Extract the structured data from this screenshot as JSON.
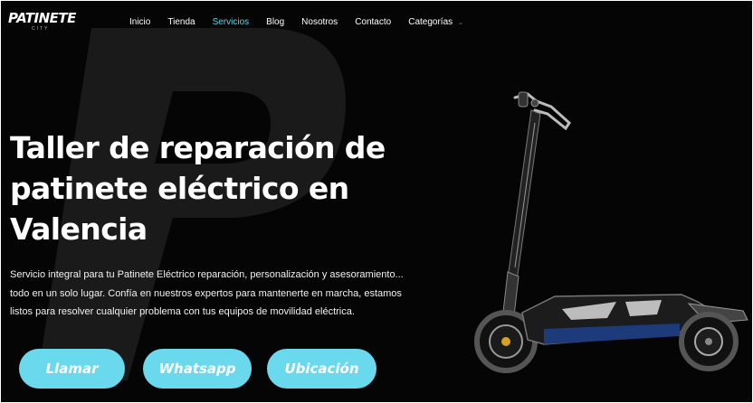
{
  "logo": {
    "text": "PATINETE",
    "subtext": "CITY"
  },
  "nav": {
    "items": [
      {
        "label": "Inicio",
        "active": false
      },
      {
        "label": "Tienda",
        "active": false
      },
      {
        "label": "Servicios",
        "active": true
      },
      {
        "label": "Blog",
        "active": false
      },
      {
        "label": "Nosotros",
        "active": false
      },
      {
        "label": "Contacto",
        "active": false
      },
      {
        "label": "Categorías",
        "active": false
      }
    ],
    "dropdown_icon": "chevron-down-icon"
  },
  "hero": {
    "title_lines": [
      "Taller de reparación de",
      "patinete eléctrico en",
      "Valencia"
    ],
    "description": "Servicio integral para tu Patinete Eléctrico reparación, personalización y asesoramiento... todo en un solo lugar. Confía en nuestros expertos para mantenerte en marcha, estamos listos para resolver cualquier problema con tus equipos de movilidad eléctrica.",
    "buttons": [
      {
        "label": "Llamar"
      },
      {
        "label": "Whatsapp"
      },
      {
        "label": "Ubicación"
      }
    ]
  },
  "colors": {
    "accent": "#5ad6e8",
    "button": "#6ad9ee",
    "background": "#050505",
    "text": "#ffffff"
  }
}
